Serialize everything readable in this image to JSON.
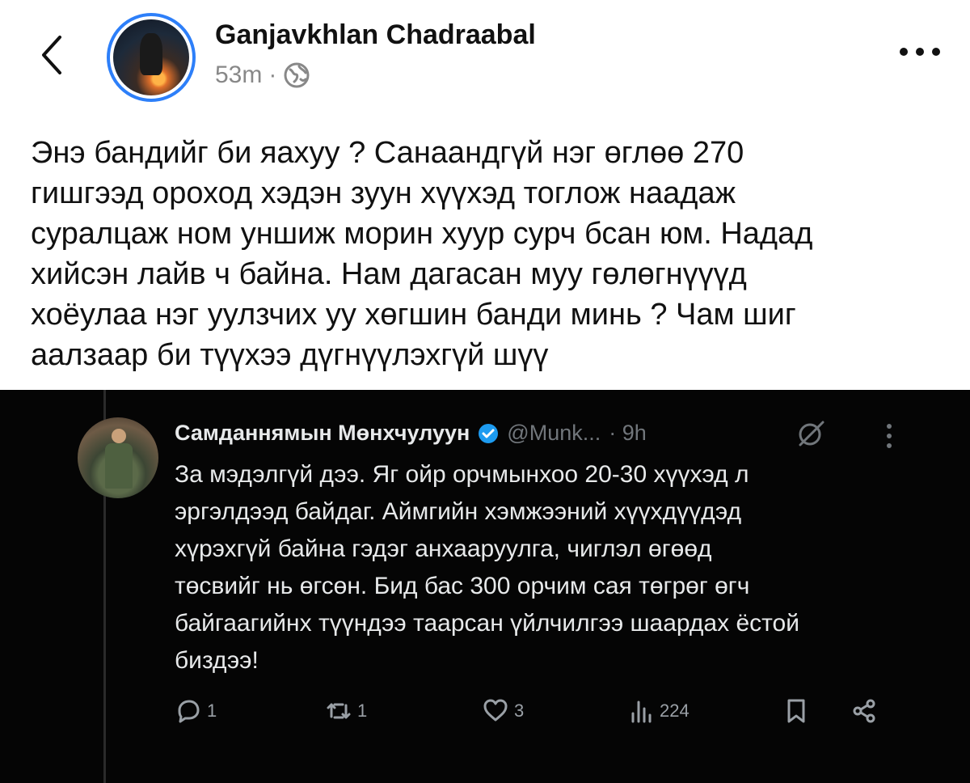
{
  "header": {
    "author": "Ganjavkhlan Chadraabal",
    "time": "53m",
    "separator": "·",
    "icons": {
      "back": "chevron-left-icon",
      "visibility": "globe-icon",
      "more": "more-dots-icon"
    }
  },
  "post": {
    "text": "Энэ бандийг би яахуу ? Санаандгүй нэг өглөө 270\nгишгээд ороход хэдэн зуун хүүхэд тоглож наадаж\nсуралцаж ном уншиж морин хуур сурч бсан юм. Надад\nхийсэн лайв ч байна. Нам дагасан муу гөлөгнүүүд\nхоёулаа нэг уулзчих уу хөгшин банди минь ? Чам шиг\nаалзаар би түүхээ дүгнүүлэхгүй шүү"
  },
  "tweet": {
    "name": "Самданнямын Мөнхчулуун",
    "handle": "@Munk...",
    "time": "· 9h",
    "text": "За мэдэлгүй дээ. Яг ойр орчмынхоо 20-30 хүүхэд л\nэргэлдээд байдаг. Аймгийн хэмжээний хүүхдүүдэд\nхүрэхгүй байна гэдэг анхааруулга, чиглэл өгөөд\nтөсвийг нь өгсөн. Бид бас 300 орчим сая төгрөг өгч\nбайгаагийнх түүндээ таарсан үйлчилгээ шаардах ёстой\nбиздээ!",
    "actions": {
      "replies": "1",
      "reposts": "1",
      "likes": "3",
      "views": "224"
    },
    "colors": {
      "background": "#050505",
      "text": "#e7e9ea",
      "muted": "#71767b",
      "verified": "#1d9bf0"
    }
  },
  "colors": {
    "avatar_ring": "#2d7ff9",
    "muted": "#888888"
  }
}
